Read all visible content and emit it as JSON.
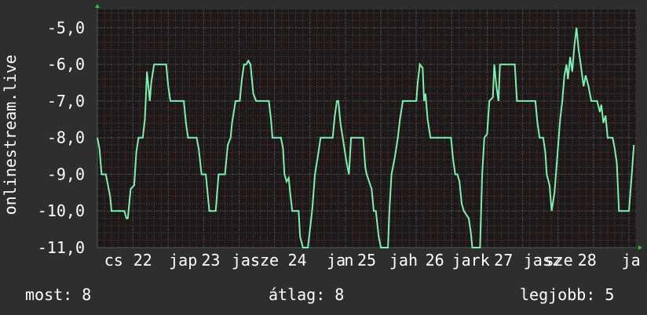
{
  "colors": {
    "background": "#2e2e2e",
    "plot_background": "#1a1a1a",
    "grid_major": "#4a4a4a",
    "grid_minor": "#8a3030",
    "line": "#7fefb0",
    "axis_arrow": "#22cc22",
    "text": "#ffffff"
  },
  "stats": {
    "now": "most: 8",
    "avg": "átlag: 8",
    "max": "legjobb: 5"
  },
  "chart_data": {
    "type": "line",
    "ylabel": "onlinestream.live",
    "ylim": [
      -11,
      -4.5
    ],
    "yticks": [
      -5,
      -6,
      -7,
      -8,
      -9,
      -10,
      -11
    ],
    "ytick_labels": [
      "-5,0",
      "-6,0",
      "-7,0",
      "-8,0",
      "-9,0",
      "-10,0",
      "-11,0"
    ],
    "xlim": [
      0,
      7.6
    ],
    "xtick_labels": [
      {
        "x": 0.23,
        "label": "cs"
      },
      {
        "x": 0.64,
        "label": "22"
      },
      {
        "x": 1.21,
        "label": "jap"
      },
      {
        "x": 1.6,
        "label": "23"
      },
      {
        "x": 2.16,
        "label": "jasz"
      },
      {
        "x": 2.36,
        "label": "sze"
      },
      {
        "x": 2.82,
        "label": "24"
      },
      {
        "x": 3.37,
        "label": "ja"
      },
      {
        "x": 3.55,
        "label": "n"
      },
      {
        "x": 3.8,
        "label": "25"
      },
      {
        "x": 4.32,
        "label": "jah"
      },
      {
        "x": 4.76,
        "label": "26"
      },
      {
        "x": 5.27,
        "label": "jark"
      },
      {
        "x": 5.73,
        "label": "27"
      },
      {
        "x": 6.28,
        "label": "jasz"
      },
      {
        "x": 6.51,
        "label": "sze"
      },
      {
        "x": 6.91,
        "label": "28"
      },
      {
        "x": 7.53,
        "label": "ja"
      }
    ],
    "series": [
      {
        "values": [
          [
            0.0,
            -8.0
          ],
          [
            0.03,
            -8.3
          ],
          [
            0.06,
            -9.0
          ],
          [
            0.12,
            -9.0
          ],
          [
            0.18,
            -9.6
          ],
          [
            0.2,
            -10.0
          ],
          [
            0.38,
            -10.0
          ],
          [
            0.41,
            -10.2
          ],
          [
            0.43,
            -10.2
          ],
          [
            0.47,
            -9.4
          ],
          [
            0.52,
            -9.3
          ],
          [
            0.55,
            -8.4
          ],
          [
            0.58,
            -8.0
          ],
          [
            0.64,
            -8.0
          ],
          [
            0.67,
            -7.5
          ],
          [
            0.7,
            -6.2
          ],
          [
            0.74,
            -7.0
          ],
          [
            0.76,
            -6.5
          ],
          [
            0.8,
            -6.0
          ],
          [
            0.97,
            -6.0
          ],
          [
            1.0,
            -6.6
          ],
          [
            1.03,
            -7.0
          ],
          [
            1.22,
            -7.0
          ],
          [
            1.25,
            -7.6
          ],
          [
            1.28,
            -8.0
          ],
          [
            1.4,
            -8.0
          ],
          [
            1.43,
            -8.3
          ],
          [
            1.47,
            -9.0
          ],
          [
            1.53,
            -9.0
          ],
          [
            1.58,
            -10.0
          ],
          [
            1.67,
            -10.0
          ],
          [
            1.71,
            -9.0
          ],
          [
            1.8,
            -9.0
          ],
          [
            1.84,
            -8.2
          ],
          [
            1.88,
            -8.0
          ],
          [
            1.9,
            -7.6
          ],
          [
            1.95,
            -7.0
          ],
          [
            2.01,
            -7.0
          ],
          [
            2.04,
            -6.4
          ],
          [
            2.07,
            -6.0
          ],
          [
            2.1,
            -6.0
          ],
          [
            2.13,
            -5.9
          ],
          [
            2.16,
            -6.0
          ],
          [
            2.2,
            -6.8
          ],
          [
            2.24,
            -7.0
          ],
          [
            2.42,
            -7.0
          ],
          [
            2.45,
            -7.5
          ],
          [
            2.47,
            -8.0
          ],
          [
            2.59,
            -8.0
          ],
          [
            2.62,
            -8.3
          ],
          [
            2.64,
            -9.0
          ],
          [
            2.67,
            -9.2
          ],
          [
            2.7,
            -9.1
          ],
          [
            2.72,
            -9.5
          ],
          [
            2.75,
            -10.0
          ],
          [
            2.84,
            -10.0
          ],
          [
            2.86,
            -10.7
          ],
          [
            2.9,
            -11.0
          ],
          [
            2.97,
            -11.0
          ],
          [
            3.0,
            -10.5
          ],
          [
            3.03,
            -10.0
          ],
          [
            3.07,
            -9.0
          ],
          [
            3.12,
            -8.4
          ],
          [
            3.15,
            -8.0
          ],
          [
            3.32,
            -8.0
          ],
          [
            3.35,
            -7.4
          ],
          [
            3.38,
            -7.0
          ],
          [
            3.4,
            -7.0
          ],
          [
            3.43,
            -7.6
          ],
          [
            3.47,
            -8.1
          ],
          [
            3.51,
            -8.6
          ],
          [
            3.55,
            -9.0
          ],
          [
            3.58,
            -8.0
          ],
          [
            3.75,
            -8.0
          ],
          [
            3.78,
            -8.8
          ],
          [
            3.8,
            -9.0
          ],
          [
            3.87,
            -9.4
          ],
          [
            3.9,
            -10.0
          ],
          [
            3.93,
            -10.0
          ],
          [
            3.97,
            -10.7
          ],
          [
            4.0,
            -11.0
          ],
          [
            4.1,
            -11.0
          ],
          [
            4.12,
            -10.0
          ],
          [
            4.15,
            -9.0
          ],
          [
            4.2,
            -8.5
          ],
          [
            4.24,
            -8.0
          ],
          [
            4.27,
            -7.5
          ],
          [
            4.31,
            -7.0
          ],
          [
            4.5,
            -7.0
          ],
          [
            4.52,
            -6.5
          ],
          [
            4.55,
            -6.0
          ],
          [
            4.59,
            -6.1
          ],
          [
            4.61,
            -7.0
          ],
          [
            4.63,
            -6.8
          ],
          [
            4.66,
            -7.5
          ],
          [
            4.7,
            -8.0
          ],
          [
            4.99,
            -8.0
          ],
          [
            5.02,
            -8.6
          ],
          [
            5.05,
            -9.0
          ],
          [
            5.08,
            -9.0
          ],
          [
            5.11,
            -9.2
          ],
          [
            5.14,
            -9.8
          ],
          [
            5.17,
            -10.0
          ],
          [
            5.24,
            -10.2
          ],
          [
            5.27,
            -10.6
          ],
          [
            5.29,
            -11.0
          ],
          [
            5.4,
            -11.0
          ],
          [
            5.43,
            -9.0
          ],
          [
            5.46,
            -8.0
          ],
          [
            5.5,
            -7.9
          ],
          [
            5.53,
            -7.0
          ],
          [
            5.58,
            -6.9
          ],
          [
            5.6,
            -6.0
          ],
          [
            5.63,
            -6.6
          ],
          [
            5.66,
            -7.0
          ],
          [
            5.68,
            -6.0
          ],
          [
            5.89,
            -6.0
          ],
          [
            5.92,
            -7.0
          ],
          [
            6.18,
            -7.0
          ],
          [
            6.21,
            -7.6
          ],
          [
            6.24,
            -8.0
          ],
          [
            6.29,
            -8.0
          ],
          [
            6.32,
            -8.4
          ],
          [
            6.34,
            -9.0
          ],
          [
            6.38,
            -9.3
          ],
          [
            6.41,
            -10.0
          ],
          [
            6.45,
            -9.5
          ],
          [
            6.47,
            -9.0
          ],
          [
            6.51,
            -8.0
          ],
          [
            6.53,
            -7.5
          ],
          [
            6.56,
            -7.0
          ],
          [
            6.59,
            -6.3
          ],
          [
            6.62,
            -6.0
          ],
          [
            6.64,
            -6.4
          ],
          [
            6.67,
            -5.8
          ],
          [
            6.7,
            -6.2
          ],
          [
            6.73,
            -5.5
          ],
          [
            6.76,
            -5.0
          ],
          [
            6.79,
            -5.6
          ],
          [
            6.82,
            -6.0
          ],
          [
            6.86,
            -6.6
          ],
          [
            6.89,
            -6.3
          ],
          [
            6.93,
            -6.6
          ],
          [
            6.97,
            -7.0
          ],
          [
            7.05,
            -7.0
          ],
          [
            7.09,
            -7.3
          ],
          [
            7.11,
            -7.1
          ],
          [
            7.14,
            -7.6
          ],
          [
            7.17,
            -7.4
          ],
          [
            7.2,
            -8.0
          ],
          [
            7.27,
            -8.0
          ],
          [
            7.3,
            -8.3
          ],
          [
            7.33,
            -8.7
          ],
          [
            7.36,
            -10.0
          ],
          [
            7.43,
            -10.0
          ],
          [
            7.46,
            -10.0
          ],
          [
            7.5,
            -10.0
          ],
          [
            7.54,
            -9.0
          ],
          [
            7.57,
            -8.2
          ]
        ]
      }
    ]
  }
}
